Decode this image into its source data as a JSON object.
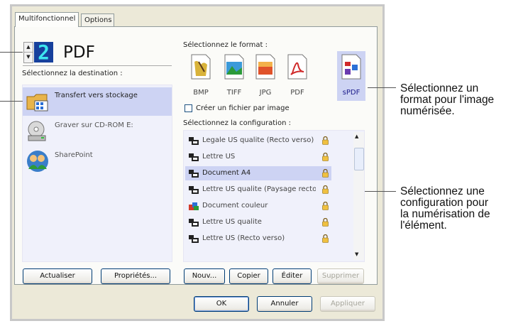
{
  "tabs": [
    {
      "label": "Multifonctionnel",
      "active": true
    },
    {
      "label": "Options",
      "active": false
    }
  ],
  "counter": {
    "digit": "2",
    "label": "PDF"
  },
  "destination": {
    "heading": "Sélectionnez la destination :",
    "items": [
      {
        "label": "Transfert vers stockage",
        "icon": "folder-storage-icon",
        "selected": true
      },
      {
        "label": "Graver sur CD-ROM  E:",
        "icon": "cd-drive-icon",
        "selected": false
      },
      {
        "label": "SharePoint",
        "icon": "sharepoint-icon",
        "selected": false
      }
    ]
  },
  "format": {
    "heading": "Sélectionnez le format :",
    "items": [
      {
        "label": "BMP",
        "icon": "bmp-icon",
        "selected": false
      },
      {
        "label": "TIFF",
        "icon": "tiff-icon",
        "selected": false
      },
      {
        "label": "JPG",
        "icon": "jpg-icon",
        "selected": false
      },
      {
        "label": "PDF",
        "icon": "pdf-icon",
        "selected": false
      },
      {
        "label": "sPDF",
        "icon": "spdf-icon",
        "selected": true
      }
    ],
    "checkbox_label": "Créer un fichier par image",
    "checkbox_checked": false
  },
  "configuration": {
    "heading": "Sélectionnez la configuration :",
    "items": [
      {
        "label": "Legale US qualite (Recto verso)",
        "selected": false,
        "color": "#333"
      },
      {
        "label": "Lettre US",
        "selected": false,
        "color": "#333"
      },
      {
        "label": "Document A4",
        "selected": true,
        "color": "#333"
      },
      {
        "label": "Lettre US qualite (Paysage recto ...",
        "selected": false,
        "color": "#333"
      },
      {
        "label": "Document couleur",
        "selected": false,
        "color": "multi"
      },
      {
        "label": "Lettre US qualite",
        "selected": false,
        "color": "#333"
      },
      {
        "label": "Lettre US (Recto verso)",
        "selected": false,
        "color": "#333"
      }
    ]
  },
  "buttons": {
    "refresh": "Actualiser",
    "properties": "Propriétés...",
    "new": "Nouv...",
    "copy": "Copier",
    "edit": "Éditer",
    "delete": "Supprimer",
    "ok": "OK",
    "cancel": "Annuler",
    "apply": "Appliquer"
  },
  "callouts": {
    "format": [
      "Sélectionnez un",
      "format pour l'image",
      "numérisée."
    ],
    "config": [
      "Sélectionnez une",
      "configuration pour",
      "la numérisation de",
      "l'élément."
    ]
  },
  "colors": {
    "selection": "#cdd3f3",
    "accent": "#2b6fd6",
    "counter_bg": "#16409c",
    "counter_digit": "#3ee6ee"
  }
}
